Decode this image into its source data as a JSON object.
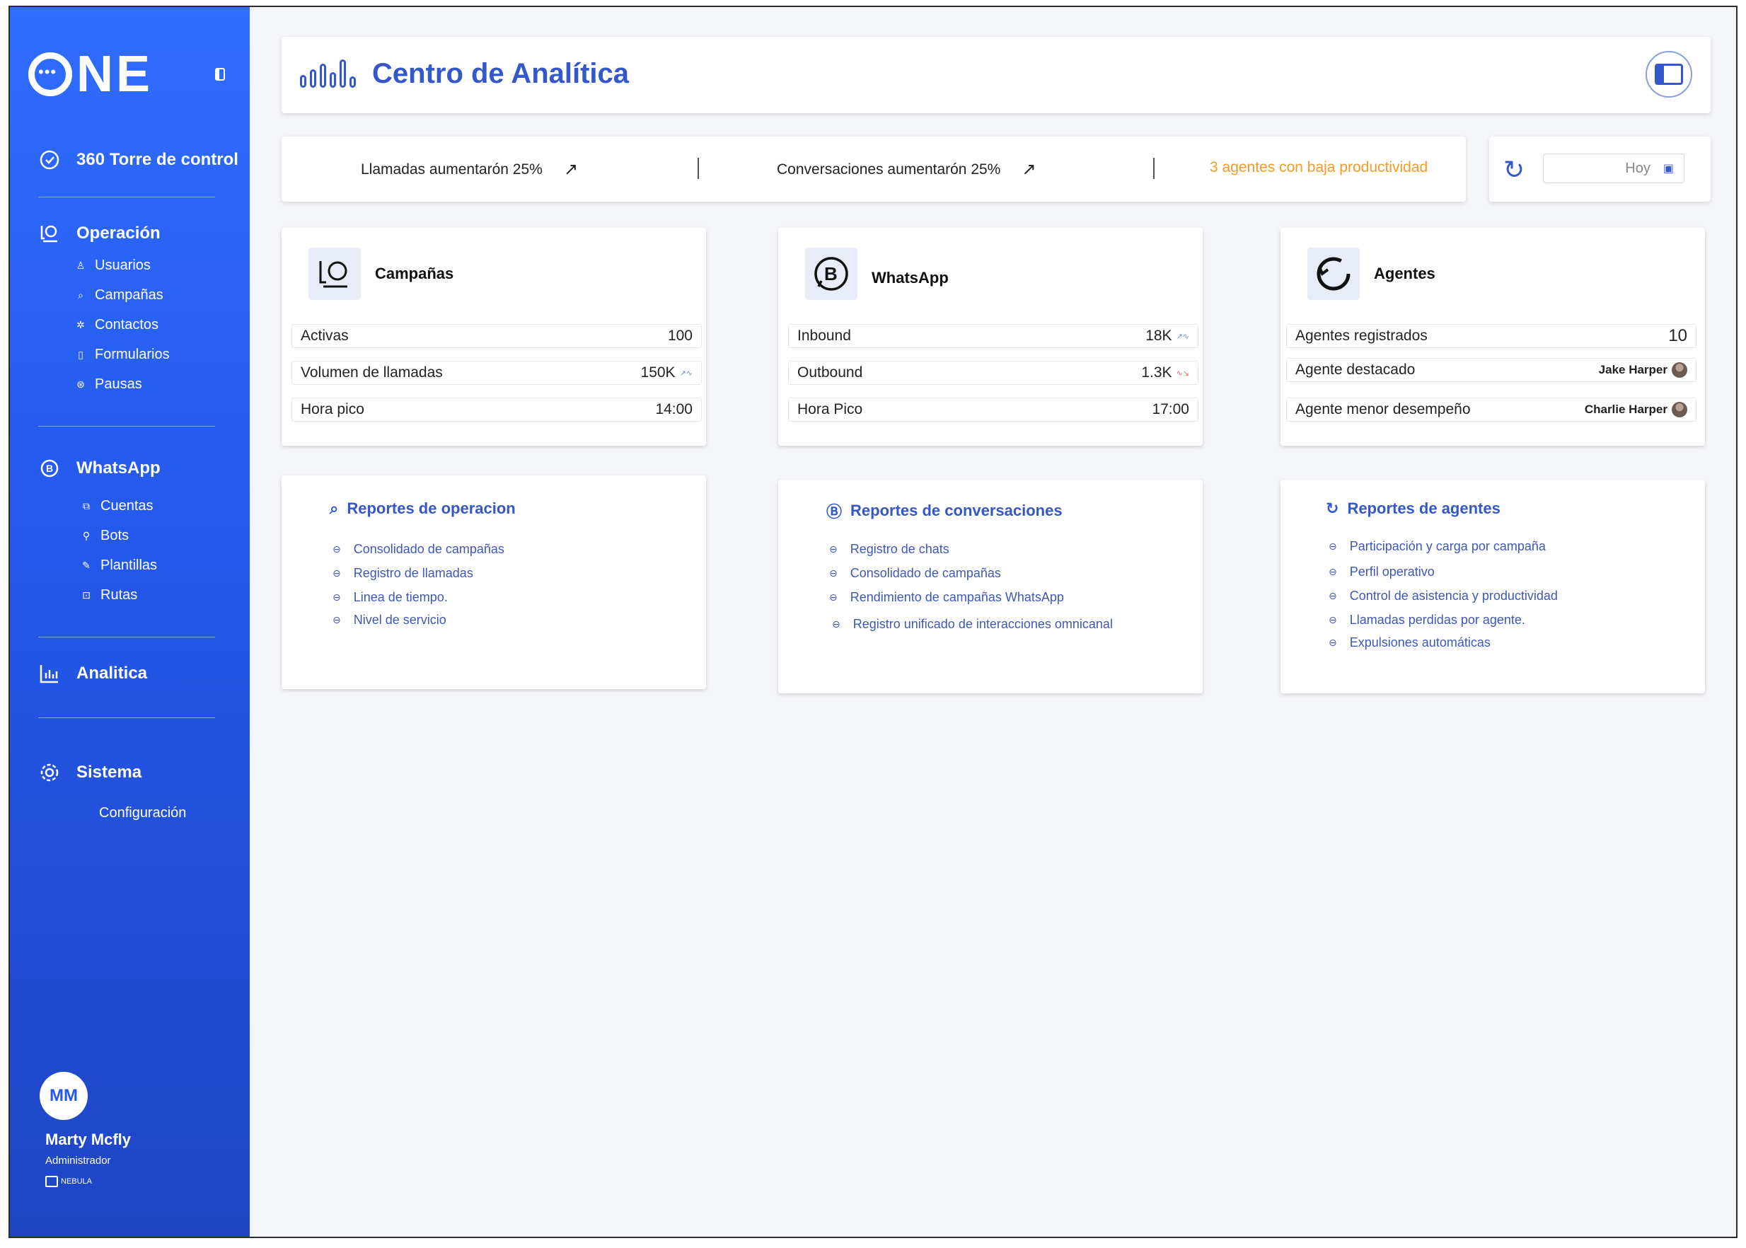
{
  "sidebar": {
    "logo": "ONE",
    "items": [
      {
        "label": "360 Torre de control",
        "icon": "target-icon"
      },
      {
        "label": "Operación",
        "icon": "chat-user-icon",
        "children": [
          {
            "label": "Usuarios",
            "icon": "user-icon"
          },
          {
            "label": "Campañas",
            "icon": "campaign-icon"
          },
          {
            "label": "Contactos",
            "icon": "contacts-icon"
          },
          {
            "label": "Formularios",
            "icon": "form-icon"
          },
          {
            "label": "Pausas",
            "icon": "pause-icon"
          }
        ]
      },
      {
        "label": "WhatsApp",
        "icon": "whatsapp-b-icon",
        "children": [
          {
            "label": "Cuentas",
            "icon": "accounts-icon"
          },
          {
            "label": "Bots",
            "icon": "bot-icon"
          },
          {
            "label": "Plantillas",
            "icon": "template-icon"
          },
          {
            "label": "Rutas",
            "icon": "route-icon"
          }
        ]
      },
      {
        "label": "Analitica",
        "icon": "bar-chart-icon"
      },
      {
        "label": "Sistema",
        "icon": "gear-icon",
        "children": [
          {
            "label": "Configuración"
          }
        ]
      }
    ],
    "profile": {
      "initials": "MM",
      "name": "Marty Mcfly",
      "role": "Administrador",
      "brand": "NEBULA"
    }
  },
  "header": {
    "title": "Centro de Analítica"
  },
  "stats": {
    "calls": "Llamadas aumentarón 25%",
    "conversations": "Conversaciones aumentarón 25%",
    "agents_warning": "3 agentes con baja productividad"
  },
  "date_filter": {
    "value": "Hoy"
  },
  "cards": {
    "campaigns": {
      "title": "Campañas",
      "rows": [
        {
          "label": "Activas",
          "value": "100"
        },
        {
          "label": "Volumen de llamadas",
          "value": "150K"
        },
        {
          "label": "Hora pico",
          "value": "14:00"
        }
      ]
    },
    "whatsapp": {
      "title": "WhatsApp",
      "rows": [
        {
          "label": "Inbound",
          "value": "18K"
        },
        {
          "label": "Outbound",
          "value": "1.3K"
        },
        {
          "label": "Hora Pico",
          "value": "17:00"
        }
      ]
    },
    "agents": {
      "title": "Agentes",
      "rows": [
        {
          "label": "Agentes registrados",
          "value": "10"
        },
        {
          "label": "Agente destacado",
          "value": "Jake Harper"
        },
        {
          "label": "Agente menor desempeño",
          "value": "Charlie Harper"
        }
      ]
    }
  },
  "reports": {
    "operation": {
      "title": "Reportes de operacion",
      "items": [
        "Consolidado de campañas",
        "Registro de  llamadas",
        "Linea de tiempo.",
        "Nivel de servicio"
      ]
    },
    "conversations": {
      "title": "Reportes de conversaciones",
      "items": [
        "Registro de chats",
        "Consolidado de campañas",
        "Rendimiento de campañas WhatsApp",
        "Registro unificado de interacciones omnicanal"
      ]
    },
    "agents": {
      "title": "Reportes de agentes",
      "items": [
        "Participación y carga por campaña",
        "Perfil operativo",
        "Control de asistencia y productividad",
        "Llamadas perdidas por agente.",
        "Expulsiones automáticas"
      ]
    }
  },
  "colors": {
    "sidebar_top": "#2f6dff",
    "sidebar_bottom": "#1f45c4",
    "accent": "#3457c9",
    "warning": "#f29b26"
  }
}
